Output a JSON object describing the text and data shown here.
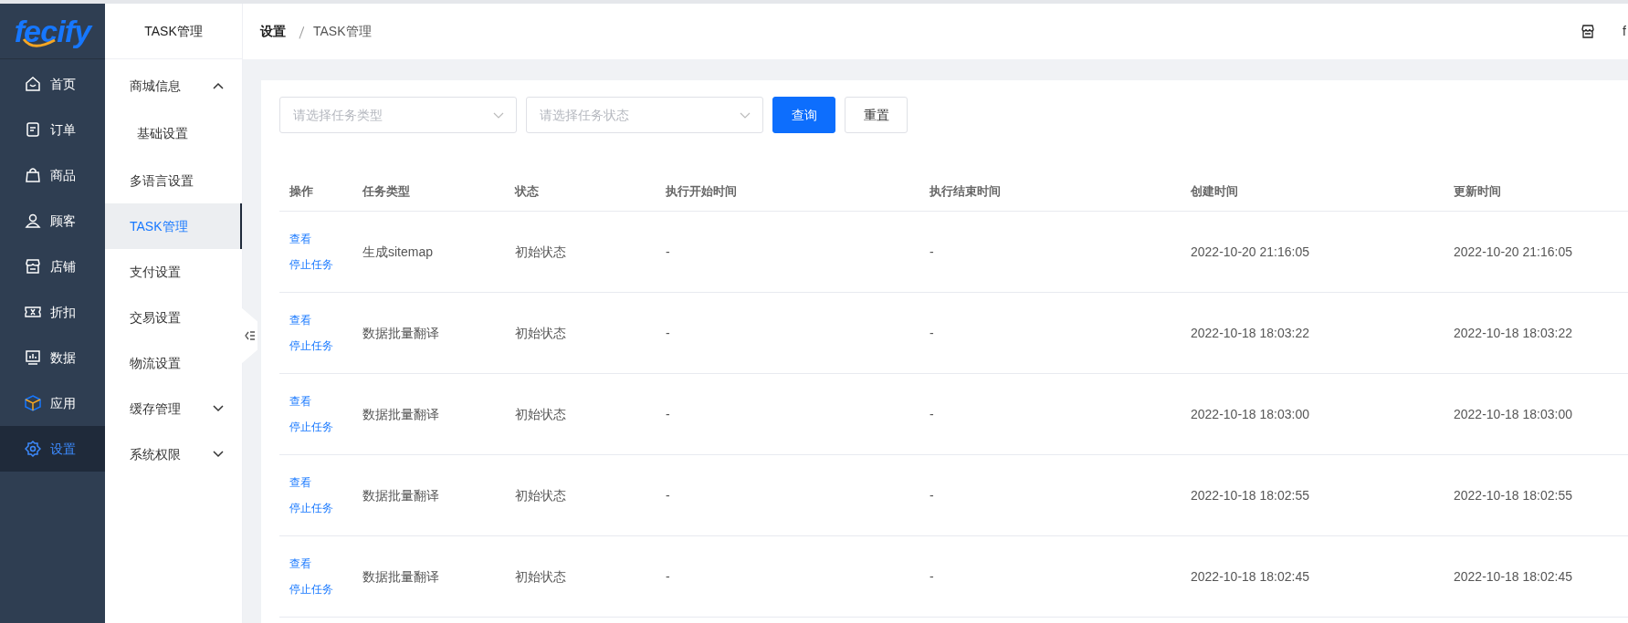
{
  "logo": "fecify",
  "nav": [
    {
      "label": "首页",
      "selected": false
    },
    {
      "label": "订单",
      "selected": false
    },
    {
      "label": "商品",
      "selected": false
    },
    {
      "label": "顾客",
      "selected": false
    },
    {
      "label": "店铺",
      "selected": false
    },
    {
      "label": "折扣",
      "selected": false
    },
    {
      "label": "数据",
      "selected": false
    },
    {
      "label": "应用",
      "selected": false
    },
    {
      "label": "设置",
      "selected": true
    }
  ],
  "submenu": {
    "title": "TASK管理",
    "items": [
      {
        "label": "商城信息",
        "expanded": true,
        "children": [
          {
            "label": "基础设置",
            "selected": false
          }
        ],
        "selected": false
      },
      {
        "label": "多语言设置",
        "selected": false
      },
      {
        "label": "TASK管理",
        "selected": true
      },
      {
        "label": "支付设置",
        "selected": false
      },
      {
        "label": "交易设置",
        "selected": false
      },
      {
        "label": "物流设置",
        "selected": false
      },
      {
        "label": "缓存管理",
        "expanded": false,
        "selected": false
      },
      {
        "label": "系统权限",
        "expanded": false,
        "selected": false
      }
    ]
  },
  "breadcrumb": [
    "设置",
    "TASK管理"
  ],
  "header_user": "f",
  "filters": [
    {
      "placeholder": "请选择任务类型"
    },
    {
      "placeholder": "请选择任务状态"
    }
  ],
  "buttons": [
    {
      "label": "查询",
      "kind": "primary"
    },
    {
      "label": "重置",
      "kind": "default"
    }
  ],
  "table": {
    "columns": [
      "操作",
      "任务类型",
      "状态",
      "执行开始时间",
      "执行结束时间",
      "创建时间",
      "更新时间"
    ],
    "rows": [
      {
        "cells": [
          [
            "查看",
            "停止任务"
          ],
          "生成sitemap",
          "初始状态",
          "-",
          "-",
          "2022-10-20 21:16:05",
          "2022-10-20 21:16:05"
        ]
      },
      {
        "cells": [
          [
            "查看",
            "停止任务"
          ],
          "数据批量翻译",
          "初始状态",
          "-",
          "-",
          "2022-10-18 18:03:22",
          "2022-10-18 18:03:22"
        ]
      },
      {
        "cells": [
          [
            "查看",
            "停止任务"
          ],
          "数据批量翻译",
          "初始状态",
          "-",
          "-",
          "2022-10-18 18:03:00",
          "2022-10-18 18:03:00"
        ]
      },
      {
        "cells": [
          [
            "查看",
            "停止任务"
          ],
          "数据批量翻译",
          "初始状态",
          "-",
          "-",
          "2022-10-18 18:02:55",
          "2022-10-18 18:02:55"
        ]
      },
      {
        "cells": [
          [
            "查看",
            "停止任务"
          ],
          "数据批量翻译",
          "初始状态",
          "-",
          "-",
          "2022-10-18 18:02:45",
          "2022-10-18 18:02:45"
        ]
      }
    ]
  }
}
